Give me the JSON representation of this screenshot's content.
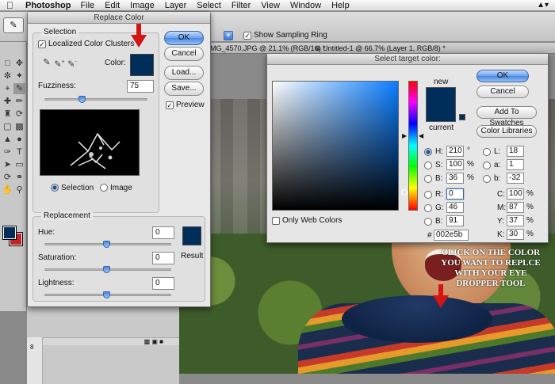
{
  "menubar": {
    "app_name": "Photoshop",
    "items": [
      "File",
      "Edit",
      "Image",
      "Layer",
      "Select",
      "Filter",
      "View",
      "Window",
      "Help"
    ]
  },
  "options_bar": {
    "show_sampling_ring_label": "Show Sampling Ring",
    "show_sampling_ring_checked": true
  },
  "doc_tabs": {
    "tab1": "MG_4570.JPG @ 21.1% (RGB/16) *",
    "tab2": "Untitled-1 @ 66.7% (Layer 1, RGB/8) *"
  },
  "replace_color": {
    "title": "Replace Color",
    "selection_group": "Selection",
    "localized_label": "Localized Color Clusters",
    "localized_checked": true,
    "color_label": "Color:",
    "selected_color": "#002e5b",
    "fuzziness_label": "Fuzziness:",
    "fuzziness_value": "75",
    "fuzziness_fraction": 0.375,
    "radio_selection": "Selection",
    "radio_image": "Image",
    "selected_radio": "Selection",
    "buttons": {
      "ok": "OK",
      "cancel": "Cancel",
      "load": "Load...",
      "save": "Save..."
    },
    "preview_label": "Preview",
    "preview_checked": true,
    "replacement_group": "Replacement",
    "hue_label": "Hue:",
    "hue_value": "0",
    "saturation_label": "Saturation:",
    "saturation_value": "0",
    "lightness_label": "Lightness:",
    "lightness_value": "0",
    "result_label": "Result",
    "result_color": "#002e5b"
  },
  "select_target_color": {
    "title": "Select target color:",
    "new_label": "new",
    "current_label": "current",
    "buttons": {
      "ok": "OK",
      "cancel": "Cancel",
      "add_to_swatches": "Add To Swatches",
      "color_libraries": "Color Libraries"
    },
    "only_web_colors_label": "Only Web Colors",
    "hsb": {
      "h_label": "H:",
      "h": "210",
      "h_unit": "°",
      "s_label": "S:",
      "s": "100",
      "s_unit": "%",
      "b_label": "B:",
      "b": "36",
      "b_unit": "%"
    },
    "rgb": {
      "r_label": "R:",
      "r": "0",
      "g_label": "G:",
      "g": "46",
      "b_label": "B:",
      "b": "91"
    },
    "lab": {
      "l_label": "L:",
      "l": "18",
      "a_label": "a:",
      "a": "1",
      "b_label": "b:",
      "b": "-32"
    },
    "cmyk": {
      "c_label": "C:",
      "c": "100",
      "m_label": "M:",
      "m": "87",
      "y_label": "Y:",
      "y": "37",
      "k_label": "K:",
      "k": "30",
      "unit": "%"
    },
    "hex_label": "#",
    "hex": "002e5b"
  },
  "annotation": {
    "text_lines": [
      "CLICK ON THE COLOR",
      "YOU WANT TO REPLCE",
      "WITH YOUR EYE",
      "DROPPER TOOL"
    ]
  },
  "colors": {
    "accent": "#c80a0a",
    "target": "#002e5b",
    "background_swatch": "#c0242a"
  },
  "layer_panel": {
    "ruler_mark": "8"
  }
}
